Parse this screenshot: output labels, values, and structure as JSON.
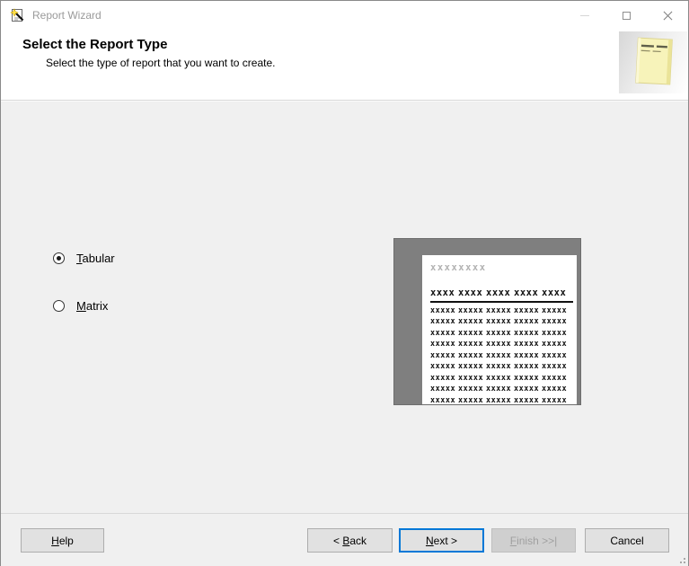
{
  "window": {
    "title": "Report Wizard",
    "controls": {
      "minimize": "minimize",
      "maximize": "maximize",
      "close": "close"
    }
  },
  "header": {
    "title": "Select the Report Type",
    "subtitle": "Select the type of report that you want to create.",
    "icon": "yellow-report-page"
  },
  "options": [
    {
      "name": "tabular",
      "accel": "T",
      "rest": "abular",
      "selected": true
    },
    {
      "name": "matrix",
      "accel": "M",
      "rest": "atrix",
      "selected": false
    }
  ],
  "preview": {
    "title_placeholder": "xxxxxxxx",
    "header_cell": "xxxx",
    "data_cell": "xxxxx",
    "columns": 5,
    "rows": 11
  },
  "footer": {
    "buttons": [
      {
        "name": "help",
        "pre": "",
        "accel": "H",
        "post": "elp",
        "enabled": true,
        "default": false
      },
      {
        "name": "back",
        "pre": "< ",
        "accel": "B",
        "post": "ack",
        "enabled": true,
        "default": false
      },
      {
        "name": "next",
        "pre": "",
        "accel": "N",
        "post": "ext >",
        "enabled": true,
        "default": true
      },
      {
        "name": "finish",
        "pre": "",
        "accel": "F",
        "post": "inish >>|",
        "enabled": false,
        "default": false
      },
      {
        "name": "cancel",
        "pre": "Cancel",
        "accel": "",
        "post": "",
        "enabled": true,
        "default": false
      }
    ]
  },
  "colors": {
    "accent_blue": "#0078d7",
    "preview_gray": "#7f7f7f",
    "dialog_gray": "#f0f0f0",
    "disabled_text": "#a0a0a0",
    "inactive_title_text": "#9a9a9a",
    "icon_yellow": "#f7f3ba"
  }
}
